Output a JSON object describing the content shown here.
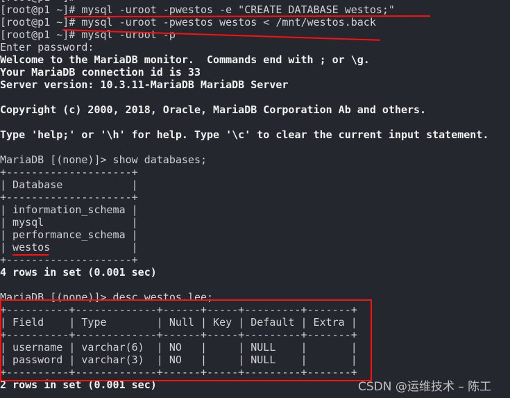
{
  "terminal": {
    "lines": [
      {
        "text": "[root@p1 ~]#",
        "bold": false
      },
      {
        "text": "[root@p1 ~]# mysql -uroot -pwestos -e \"CREATE DATABASE westos;\"",
        "bold": false
      },
      {
        "text": "[root@p1 ~]# mysql -uroot -pwestos westos < /mnt/westos.back",
        "bold": false
      },
      {
        "text": "[root@p1 ~]# mysql -uroot -p",
        "bold": false
      },
      {
        "text": "Enter password:",
        "bold": false
      },
      {
        "text": "Welcome to the MariaDB monitor.  Commands end with ; or \\g.",
        "bold": true
      },
      {
        "text": "Your MariaDB connection id is 33",
        "bold": true
      },
      {
        "text": "Server version: 10.3.11-MariaDB MariaDB Server",
        "bold": true
      },
      {
        "text": "",
        "bold": false
      },
      {
        "text": "Copyright (c) 2000, 2018, Oracle, MariaDB Corporation Ab and others.",
        "bold": true
      },
      {
        "text": "",
        "bold": false
      },
      {
        "text": "Type 'help;' or '\\h' for help. Type '\\c' to clear the current input statement.",
        "bold": true
      },
      {
        "text": "",
        "bold": false
      },
      {
        "text": "MariaDB [(none)]> show databases;",
        "bold": false
      },
      {
        "text": "+--------------------+",
        "bold": false
      },
      {
        "text": "| Database           |",
        "bold": false
      },
      {
        "text": "+--------------------+",
        "bold": false
      },
      {
        "text": "| information_schema |",
        "bold": false
      },
      {
        "text": "| mysql              |",
        "bold": false
      },
      {
        "text": "| performance_schema |",
        "bold": false
      },
      {
        "text": "| westos             |",
        "bold": false
      },
      {
        "text": "+--------------------+",
        "bold": false
      },
      {
        "text": "4 rows in set (0.001 sec)",
        "bold": true
      },
      {
        "text": "",
        "bold": false
      },
      {
        "text": "MariaDB [(none)]> desc westos.lee;",
        "bold": false
      },
      {
        "text": "+----------+-------------+------+-----+---------+-------+",
        "bold": false
      },
      {
        "text": "| Field    | Type        | Null | Key | Default | Extra |",
        "bold": false
      },
      {
        "text": "+----------+-------------+------+-----+---------+-------+",
        "bold": false
      },
      {
        "text": "| username | varchar(6)  | NO   |     | NULL    |       |",
        "bold": false
      },
      {
        "text": "| password | varchar(3)  | NO   |     | NULL    |       |",
        "bold": false
      },
      {
        "text": "+----------+-------------+------+-----+---------+-------+",
        "bold": false
      },
      {
        "text": "2 rows in set (0.001 sec)",
        "bold": true
      }
    ]
  },
  "annotation_color": "#ff1010",
  "watermark": "CSDN @运维技术 – 陈工"
}
